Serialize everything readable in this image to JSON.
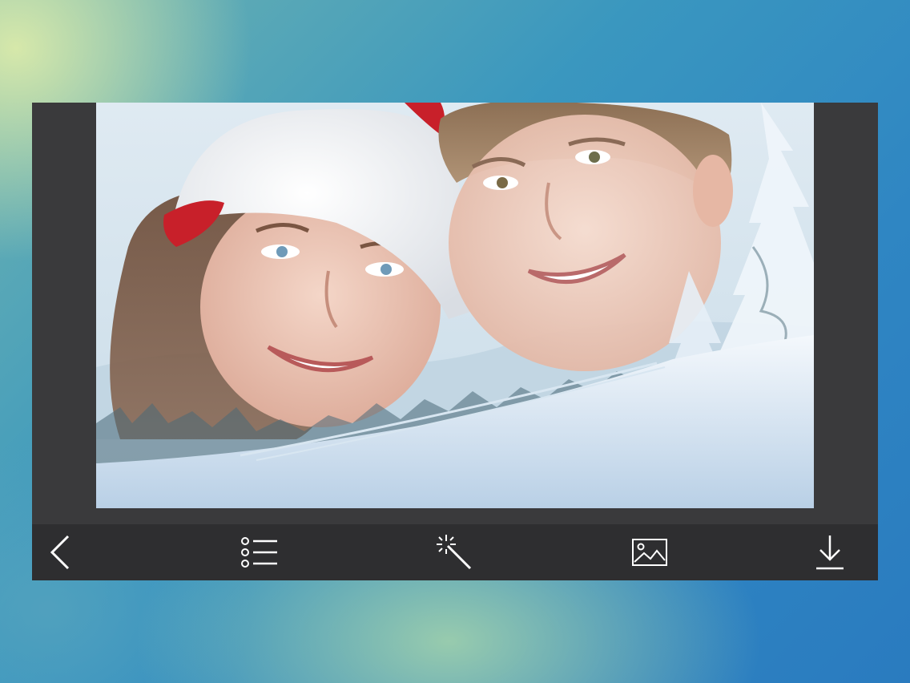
{
  "app": {
    "screen": "winter-photo-frame-editor"
  },
  "photo": {
    "description_icon": "winter-frame-photo",
    "accent_colors": {
      "hat_red": "#c8202a",
      "snow": "#eef4fa",
      "sky": "#cfe3ef",
      "tree": "#4a6a78"
    }
  },
  "toolbar": {
    "back_icon": "chevron-left-icon",
    "frames_icon": "list-icon",
    "effects_icon": "magic-wand-icon",
    "gallery_icon": "image-icon",
    "save_icon": "download-icon",
    "icon_color": "#ffffff",
    "bar_color": "#2e2e30"
  }
}
